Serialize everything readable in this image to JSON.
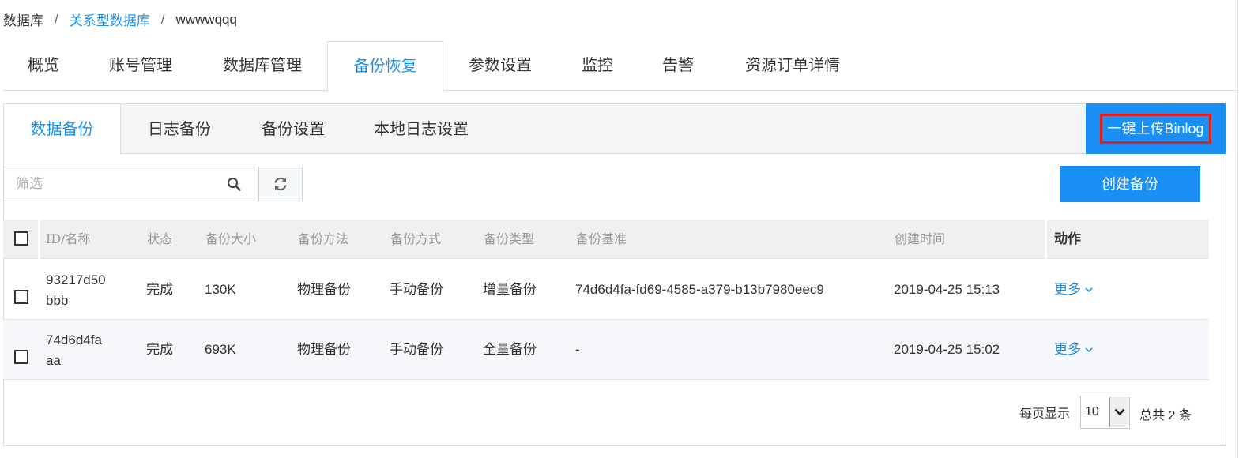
{
  "breadcrumb": {
    "items": [
      "数据库",
      "关系型数据库",
      "wwwwqqq"
    ],
    "separator": "/"
  },
  "main_tabs": {
    "items": [
      "概览",
      "账号管理",
      "数据库管理",
      "备份恢复",
      "参数设置",
      "监控",
      "告警",
      "资源订单详情"
    ],
    "active": "备份恢复"
  },
  "sub_tabs": {
    "items": [
      "数据备份",
      "日志备份",
      "备份设置",
      "本地日志设置"
    ],
    "active": "数据备份"
  },
  "binlog_button": "一键上传Binlog",
  "filter": {
    "placeholder": "筛选",
    "value": ""
  },
  "create_button": "创建备份",
  "table": {
    "headers": [
      "ID/名称",
      "状态",
      "备份大小",
      "备份方法",
      "备份方式",
      "备份类型",
      "备份基准",
      "创建时间",
      "动作"
    ],
    "rows": [
      {
        "id": "93217d50",
        "name": "bbb",
        "status": "完成",
        "size": "130K",
        "method": "物理备份",
        "mode": "手动备份",
        "type": "增量备份",
        "base": "74d6d4fa-fd69-4585-a379-b13b7980eec9",
        "created": "2019-04-25 15:13",
        "action": "更多"
      },
      {
        "id": "74d6d4fa",
        "name": "aa",
        "status": "完成",
        "size": "693K",
        "method": "物理备份",
        "mode": "手动备份",
        "type": "全量备份",
        "base": "-",
        "created": "2019-04-25 15:02",
        "action": "更多"
      }
    ]
  },
  "pagination": {
    "per_page_label": "每页显示",
    "per_page_value": "10",
    "total_label": "总共 2 条"
  },
  "colors": {
    "accent": "#1a8ff5",
    "link": "#1f8fe6",
    "highlight_border": "#e02020"
  }
}
